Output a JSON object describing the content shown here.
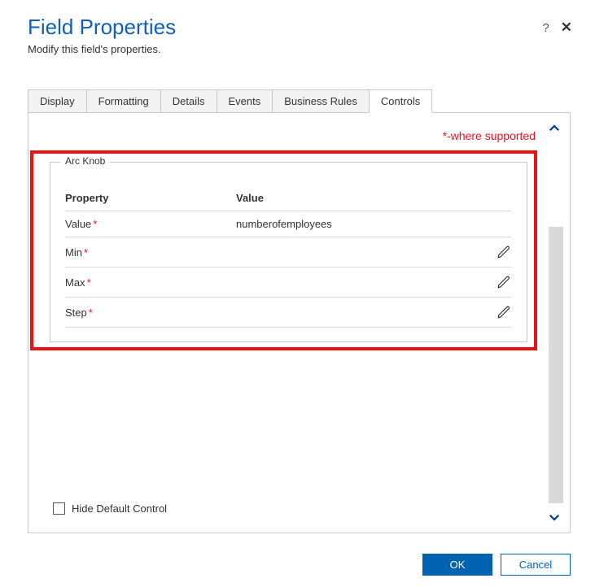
{
  "header": {
    "title": "Field Properties",
    "subtitle": "Modify this field's properties.",
    "help_tooltip": "?",
    "close_tooltip": "✕"
  },
  "tabs": [
    {
      "label": "Display"
    },
    {
      "label": "Formatting"
    },
    {
      "label": "Details"
    },
    {
      "label": "Events"
    },
    {
      "label": "Business Rules"
    },
    {
      "label": "Controls",
      "active": true
    }
  ],
  "note": "*-where supported",
  "group": {
    "legend": "Arc Knob",
    "columns": {
      "prop": "Property",
      "val": "Value"
    },
    "rows": [
      {
        "prop": "Value",
        "required": true,
        "val": "numberofemployees",
        "editable": false
      },
      {
        "prop": "Min",
        "required": true,
        "val": "",
        "editable": true
      },
      {
        "prop": "Max",
        "required": true,
        "val": "",
        "editable": true
      },
      {
        "prop": "Step",
        "required": true,
        "val": "",
        "editable": true
      }
    ]
  },
  "hide_default_label": "Hide Default Control",
  "buttons": {
    "ok": "OK",
    "cancel": "Cancel"
  },
  "required_mark": "*"
}
